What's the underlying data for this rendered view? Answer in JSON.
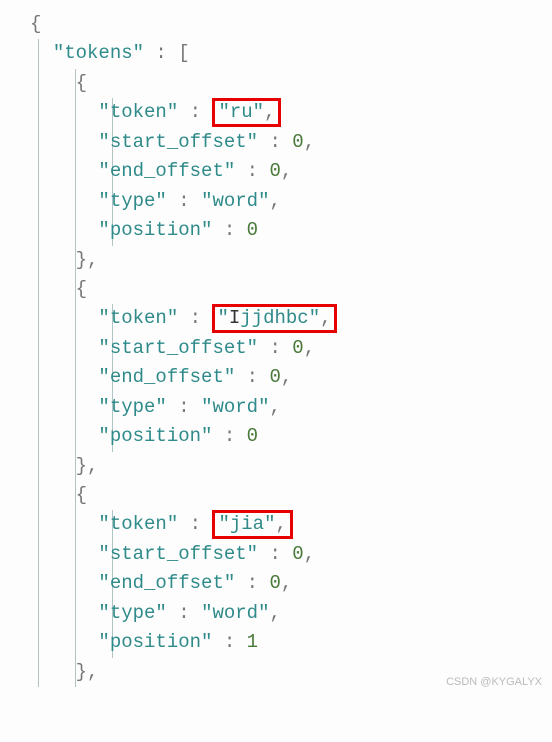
{
  "code": {
    "root_open": "{",
    "tokens_key": "\"tokens\"",
    "colon_space": " : ",
    "array_open": "[",
    "brace_open": "{",
    "brace_close": "}",
    "brace_close_comma": "},",
    "comma": ",",
    "items": [
      {
        "token_key": "\"token\"",
        "token_value": "\"ru\"",
        "start_offset_key": "\"start_offset\"",
        "start_offset_value": "0",
        "end_offset_key": "\"end_offset\"",
        "end_offset_value": "0",
        "type_key": "\"type\"",
        "type_value": "\"word\"",
        "position_key": "\"position\"",
        "position_value": "0"
      },
      {
        "token_key": "\"token\"",
        "token_value_pre": "\"",
        "token_value_cursor": "I",
        "token_value_post": "jjdhbc\"",
        "start_offset_key": "\"start_offset\"",
        "start_offset_value": "0",
        "end_offset_key": "\"end_offset\"",
        "end_offset_value": "0",
        "type_key": "\"type\"",
        "type_value": "\"word\"",
        "position_key": "\"position\"",
        "position_value": "0"
      },
      {
        "token_key": "\"token\"",
        "token_value": "\"jia\"",
        "start_offset_key": "\"start_offset\"",
        "start_offset_value": "0",
        "end_offset_key": "\"end_offset\"",
        "end_offset_value": "0",
        "type_key": "\"type\"",
        "type_value": "\"word\"",
        "position_key": "\"position\"",
        "position_value": "1"
      }
    ]
  },
  "watermark": "CSDN @KYGALYX"
}
